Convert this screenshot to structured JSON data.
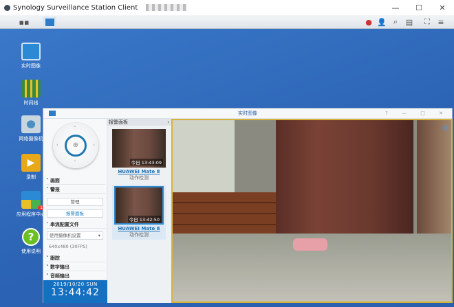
{
  "app": {
    "title": "Synology Surveillance Station Client"
  },
  "window_controls": {
    "minimize": "—",
    "maximize": "☐",
    "close": "✕"
  },
  "desktop": [
    {
      "label": "实时图像",
      "color": "#2b8ad6"
    },
    {
      "label": "时间线",
      "color": "#3b8a3b"
    },
    {
      "label": "网络摄像机",
      "color": "#9ab4c8"
    },
    {
      "label": "录制",
      "color": "#e8a81a"
    },
    {
      "label": "应用程序中心",
      "color": "#4caf50",
      "badge": "1"
    },
    {
      "label": "使用说明",
      "color": "#6bbf25",
      "glyph": "?"
    }
  ],
  "liveview": {
    "title": "实时图像",
    "controls": "? — □ ✕",
    "sections": {
      "ptz": "画面",
      "alarm": "警报",
      "stream": "串流配置文件",
      "tracking": "跟踪",
      "digital_out": "数字输出",
      "audio_out": "音频输出"
    },
    "buttons": {
      "manage": "管理",
      "alarm_panel": "报警面板"
    },
    "stream_select": "使用摄像机设置",
    "resolution": "640x480 (30FPS)",
    "date": "2019/10/20 SUN",
    "time": "13:44:42"
  },
  "alarm_panel": {
    "title": "报警面板",
    "items": [
      {
        "timestamp": "今日 13:43:09",
        "camera": "HUAWEI Mate 8",
        "event": "动作检测"
      },
      {
        "timestamp": "今日 13:42:50",
        "camera": "HUAWEI Mate 8",
        "event": "动作检测"
      }
    ]
  }
}
